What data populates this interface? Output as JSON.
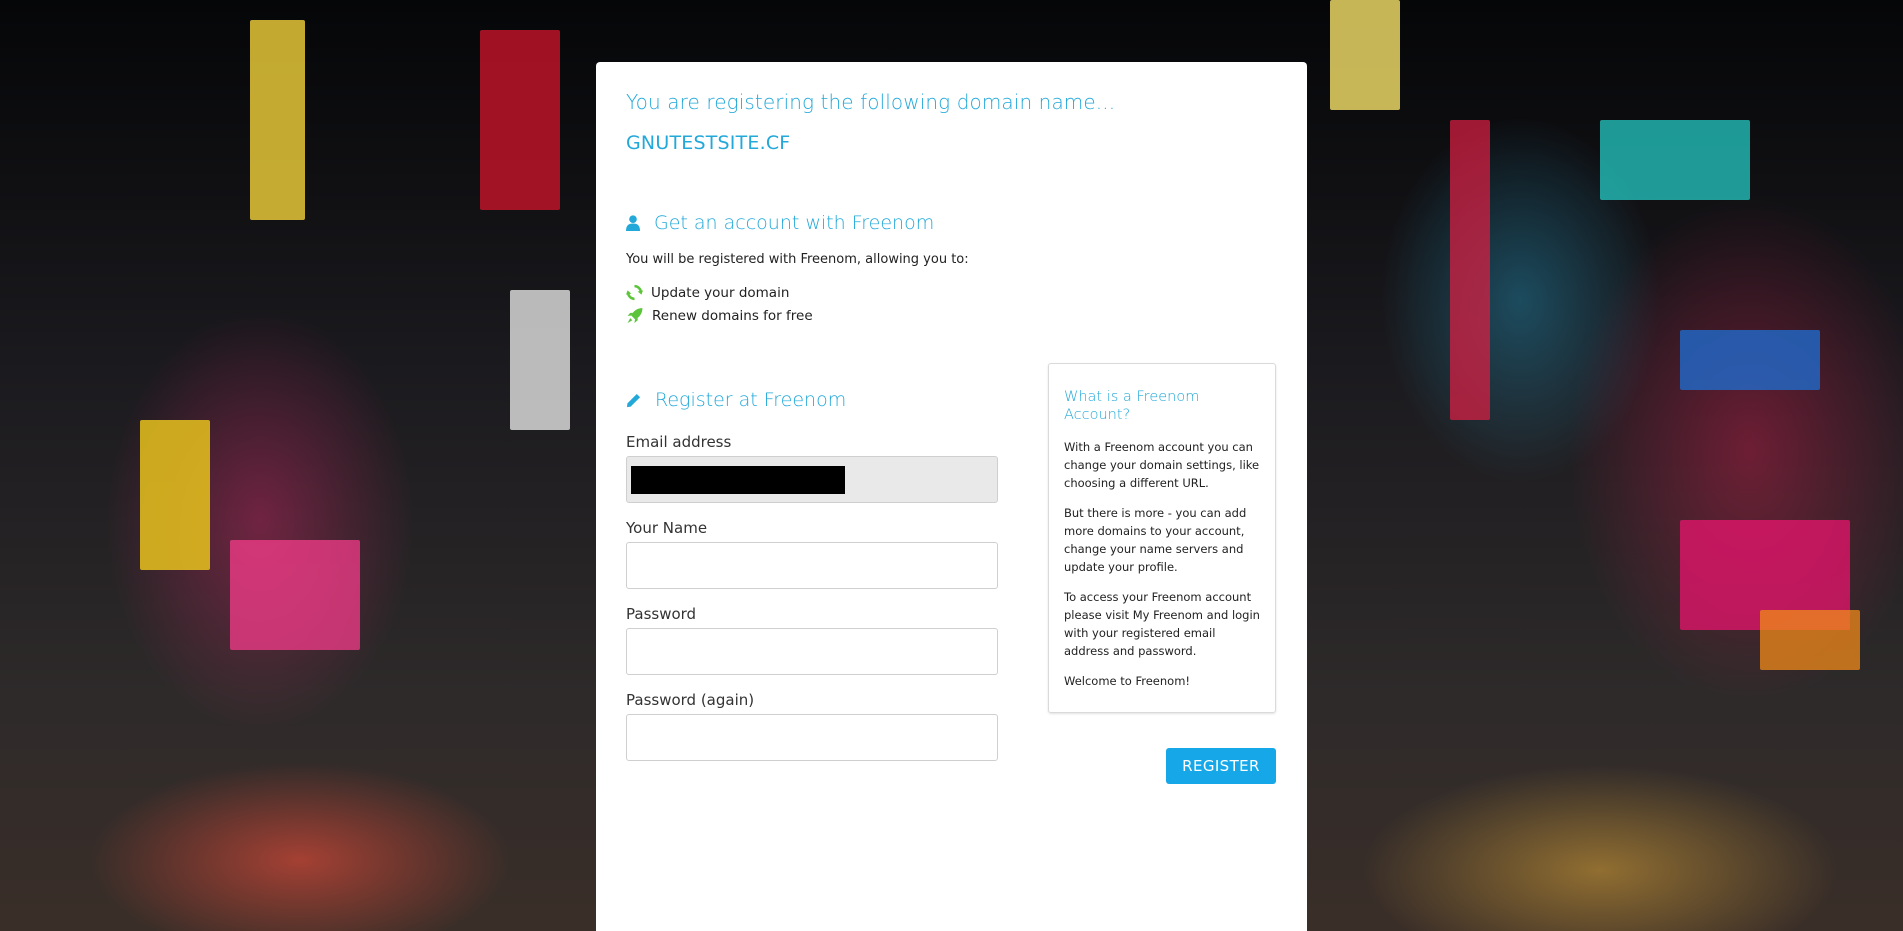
{
  "header": {
    "lead": "You are registering the following domain name...",
    "domain": "GNUTESTSITE.CF"
  },
  "account": {
    "title": "Get an account with Freenom",
    "intro": "You will be registered with Freenom, allowing you to:",
    "benefits": [
      {
        "icon": "refresh-icon",
        "label": "Update your domain"
      },
      {
        "icon": "rocket-icon",
        "label": "Renew domains for free"
      }
    ]
  },
  "register": {
    "title": "Register at Freenom",
    "email_label": "Email address",
    "name_label": "Your Name",
    "password_label": "Password",
    "password_again_label": "Password (again)",
    "button_label": "REGISTER"
  },
  "info": {
    "title": "What is a Freenom Account?",
    "p1": "With a Freenom account you can change your domain settings, like choosing a different URL.",
    "p2": "But there is more - you can add more domains to your account, change your name servers and update your profile.",
    "p3": "To access your Freenom account please visit My Freenom and login with your registered email address and password.",
    "p4": "Welcome to Freenom!"
  },
  "colors": {
    "accent": "#22a8d9",
    "button": "#16a7e8",
    "icon_green": "#5cc43a"
  }
}
